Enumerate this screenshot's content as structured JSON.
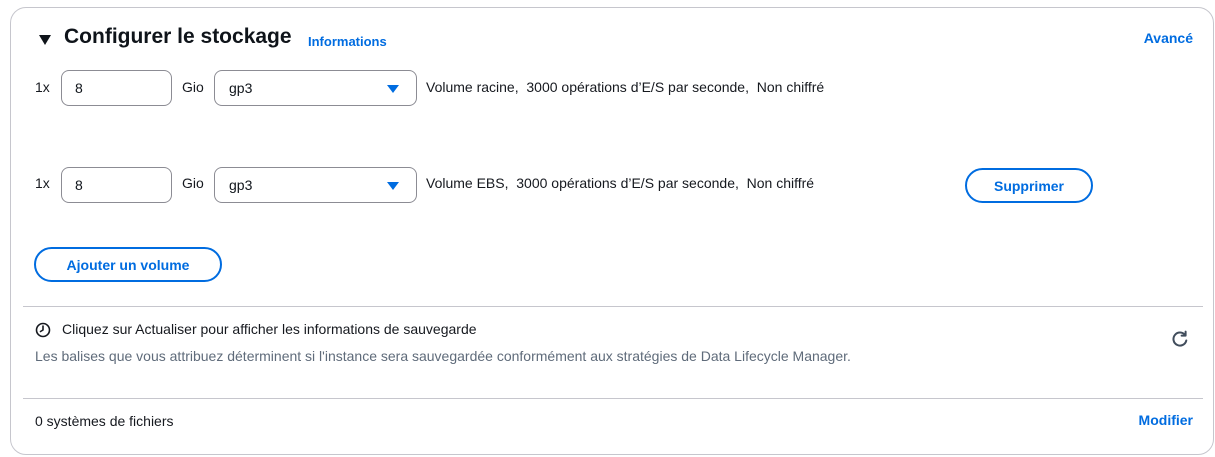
{
  "header": {
    "title": "Configurer le stockage",
    "info_link": "Informations",
    "advanced_link": "Avancé"
  },
  "volumes": [
    {
      "multiplier": "1x",
      "size": "8",
      "unit": "Gio",
      "type": "gp3",
      "description": "Volume racine,  3000 opérations d’E/S par seconde,  Non chiffré"
    },
    {
      "multiplier": "1x",
      "size": "8",
      "unit": "Gio",
      "type": "gp3",
      "description": "Volume EBS,  3000 opérations d’E/S par seconde,  Non chiffré",
      "remove_label": "Supprimer"
    }
  ],
  "add_volume_label": "Ajouter un volume",
  "backup": {
    "title": "Cliquez sur Actualiser pour afficher les informations de sauvegarde",
    "text": "Les balises que vous attribuez déterminent si l'instance sera sauvegardée conformément aux stratégies de Data Lifecycle Manager."
  },
  "filesystems": {
    "count_label": "0 systèmes de fichiers",
    "modify_link": "Modifier"
  },
  "colors": {
    "accent": "#006ce0",
    "border": "#c6c6cd",
    "muted_text": "#5f6b7a"
  },
  "icons": {
    "header_caret": "caret-down-icon",
    "select_caret": "caret-down-icon",
    "clock": "clock-icon",
    "refresh": "refresh-icon"
  }
}
